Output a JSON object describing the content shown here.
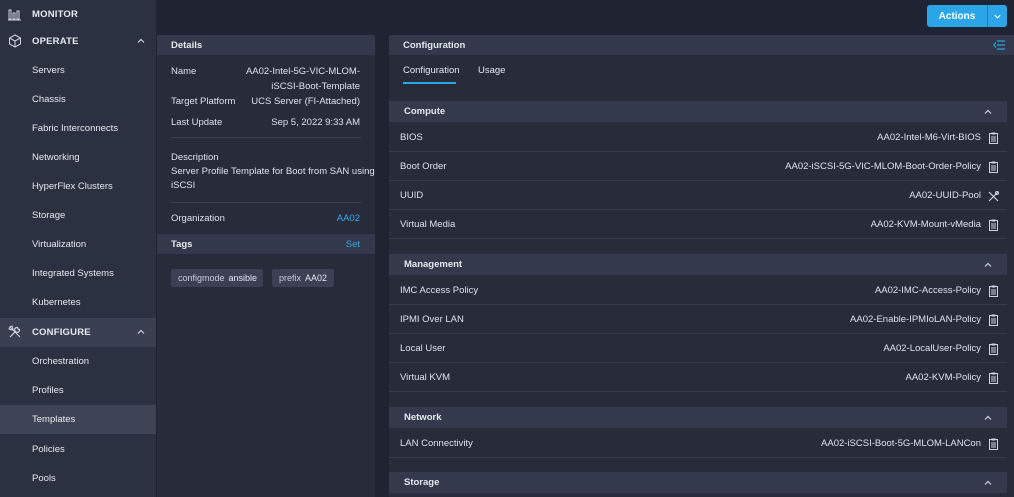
{
  "sidebar": {
    "monitor": "MONITOR",
    "operate": "OPERATE",
    "operate_items": [
      "Servers",
      "Chassis",
      "Fabric Interconnects",
      "Networking",
      "HyperFlex Clusters",
      "Storage",
      "Virtualization",
      "Integrated Systems",
      "Kubernetes"
    ],
    "configure": "CONFIGURE",
    "configure_items": [
      "Orchestration",
      "Profiles",
      "Templates",
      "Policies",
      "Pools"
    ],
    "active_item": "Templates"
  },
  "topbar": {
    "actions_label": "Actions"
  },
  "details": {
    "header": "Details",
    "name_label": "Name",
    "name_value": [
      "AA02-Intel-5G-VIC-MLOM-",
      "iSCSI-Boot-Template"
    ],
    "platform_label": "Target Platform",
    "platform_value": "UCS Server (FI-Attached)",
    "update_label": "Last Update",
    "update_value": "Sep 5, 2022 9:33 AM",
    "description_label": "Description",
    "description_value": [
      "Server Profile Template for Boot from SAN using",
      "iSCSI"
    ],
    "org_label": "Organization",
    "org_value": "AA02",
    "tags_header": "Tags",
    "tags_action": "Set",
    "tags": [
      {
        "key": "configmode",
        "value": "ansible"
      },
      {
        "key": "prefix",
        "value": "AA02"
      }
    ]
  },
  "config": {
    "header": "Configuration",
    "tabs": [
      "Configuration",
      "Usage"
    ],
    "sections": [
      {
        "title": "Compute",
        "rows": [
          {
            "label": "BIOS",
            "value": "AA02-Intel-M6-Virt-BIOS",
            "icon": "clipboard-icon"
          },
          {
            "label": "Boot Order",
            "value": "AA02-iSCSI-5G-VIC-MLOM-Boot-Order-Policy",
            "icon": "clipboard-icon"
          },
          {
            "label": "UUID",
            "value": "AA02-UUID-Pool",
            "icon": "tools-icon"
          },
          {
            "label": "Virtual Media",
            "value": "AA02-KVM-Mount-vMedia",
            "icon": "clipboard-icon"
          }
        ]
      },
      {
        "title": "Management",
        "rows": [
          {
            "label": "IMC Access Policy",
            "value": "AA02-IMC-Access-Policy",
            "icon": "clipboard-icon"
          },
          {
            "label": "IPMI Over LAN",
            "value": "AA02-Enable-IPMIoLAN-Policy",
            "icon": "clipboard-icon"
          },
          {
            "label": "Local User",
            "value": "AA02-LocalUser-Policy",
            "icon": "clipboard-icon"
          },
          {
            "label": "Virtual KVM",
            "value": "AA02-KVM-Policy",
            "icon": "clipboard-icon"
          }
        ]
      },
      {
        "title": "Network",
        "rows": [
          {
            "label": "LAN Connectivity",
            "value": "AA02-iSCSI-Boot-5G-MLOM-LANCon",
            "icon": "clipboard-icon"
          }
        ]
      },
      {
        "title": "Storage",
        "rows": []
      }
    ]
  },
  "colors": {
    "accent": "#2aa6e8",
    "link": "#3aa8ee",
    "background": "#1f2332",
    "panel": "#272b3a"
  }
}
